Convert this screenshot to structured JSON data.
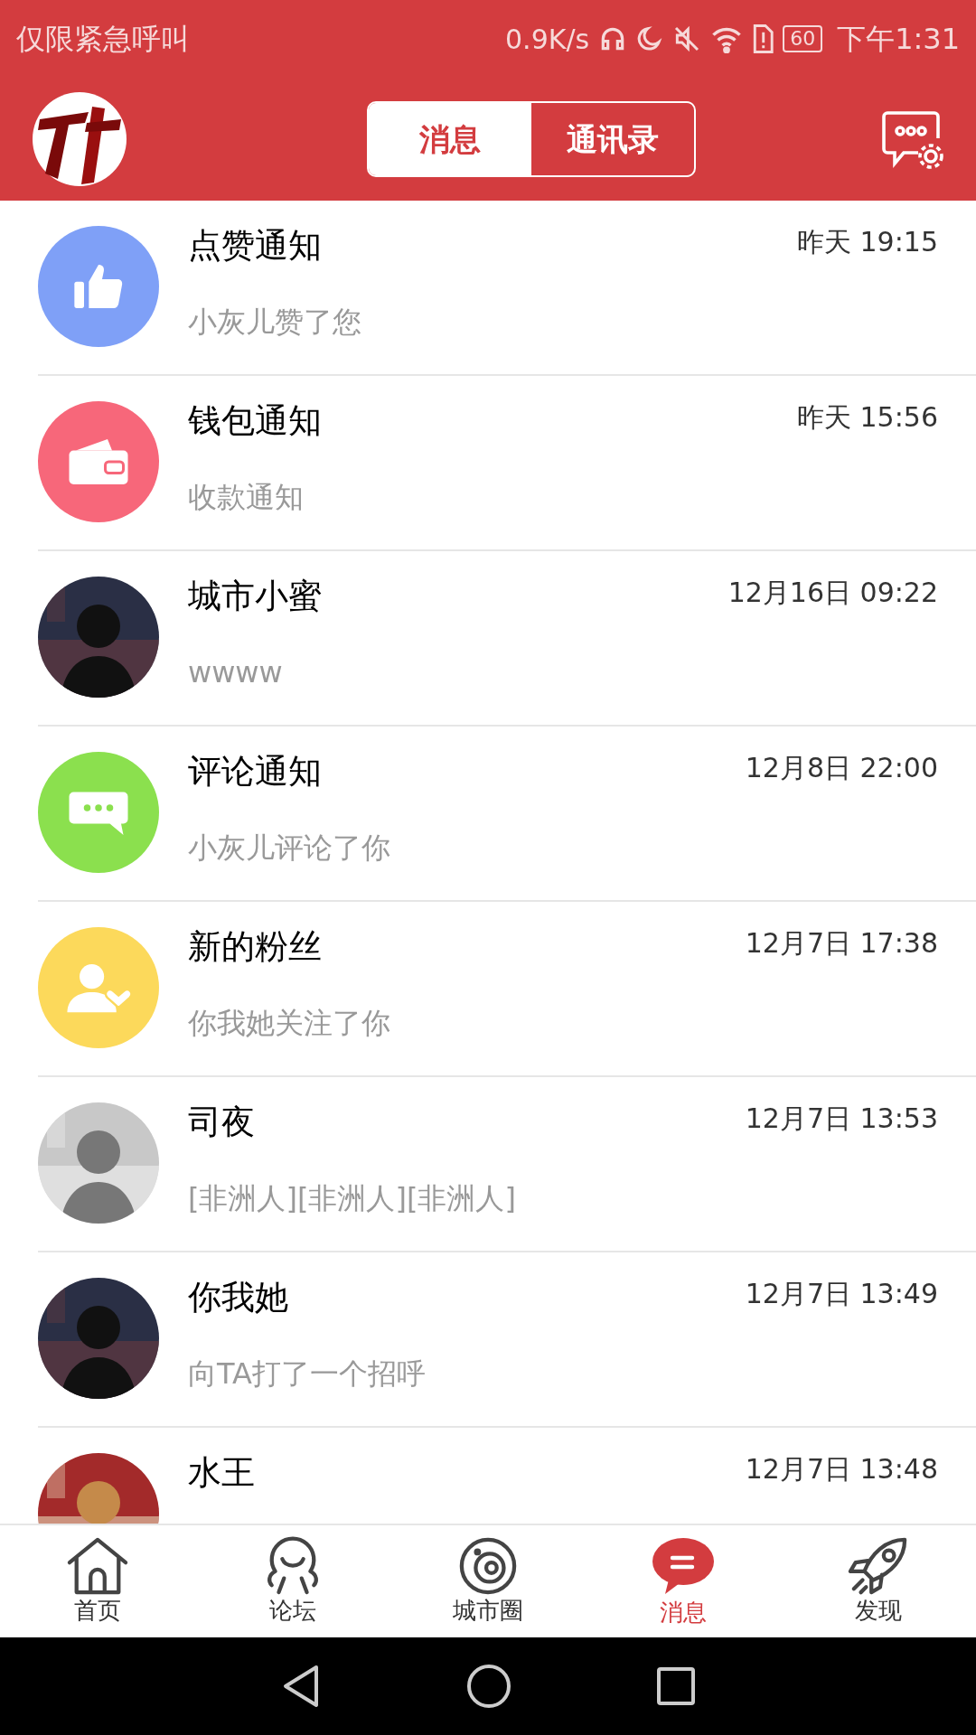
{
  "status_bar": {
    "carrier": "仅限紧急呼叫",
    "speed": "0.9K/s",
    "battery": "60",
    "time": "下午1:31"
  },
  "header": {
    "tabs": [
      {
        "label": "消息",
        "selected": true
      },
      {
        "label": "通讯录",
        "selected": false
      }
    ]
  },
  "messages": [
    {
      "avatar": {
        "kind": "thumb",
        "color": "#7fa0f7"
      },
      "name": "点赞通知",
      "time": "昨天 19:15",
      "preview": "小灰儿赞了您"
    },
    {
      "avatar": {
        "kind": "wallet",
        "color": "#f7677a"
      },
      "name": "钱包通知",
      "time": "昨天 15:56",
      "preview": "收款通知"
    },
    {
      "name": "城市小蜜",
      "time": "12月16日 09:22",
      "preview": "wwww"
    },
    {
      "avatar": {
        "kind": "chat",
        "color": "#8be04e"
      },
      "name": "评论通知",
      "time": "12月8日 22:00",
      "preview": "小灰儿评论了你"
    },
    {
      "avatar": {
        "kind": "fans",
        "color": "#fcd95b"
      },
      "name": "新的粉丝",
      "time": "12月7日 17:38",
      "preview": "你我她关注了你"
    },
    {
      "name": "司夜",
      "time": "12月7日 13:53",
      "preview": "[非洲人][非洲人][非洲人]"
    },
    {
      "name": "你我她",
      "time": "12月7日 13:49",
      "preview": "向TA打了一个招呼"
    },
    {
      "name": "水王",
      "time": "12月7日 13:48"
    }
  ],
  "bottom_nav": [
    {
      "label": "首页",
      "selected": false
    },
    {
      "label": "论坛",
      "selected": false
    },
    {
      "label": "城市圈",
      "selected": false
    },
    {
      "label": "消息",
      "selected": true
    },
    {
      "label": "发现",
      "selected": false
    }
  ]
}
